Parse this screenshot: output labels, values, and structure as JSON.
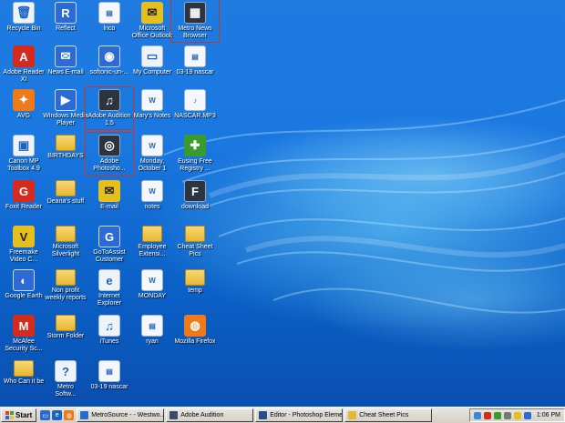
{
  "desktop_icons": [
    {
      "label": "Recycle Bin",
      "icon": "recycle-bin-icon",
      "glyph": "🗑"
    },
    {
      "label": "Reflect",
      "icon": "reflect-icon",
      "glyph": "R"
    },
    {
      "label": "lnco",
      "icon": "lnco-icon",
      "glyph": "▤"
    },
    {
      "label": "Microsoft\nOffice Outlook",
      "icon": "outlook-icon",
      "glyph": "✉"
    },
    {
      "label": "Metro News\nBrowser",
      "icon": "metro-news-browser-icon",
      "glyph": "▦"
    },
    {
      "label": "Adobe Reader\nXI",
      "icon": "adobe-reader-icon",
      "glyph": "A"
    },
    {
      "label": "News E-mail",
      "icon": "news-email-icon",
      "glyph": "✉"
    },
    {
      "label": "softonic-un-...",
      "icon": "softonic-icon",
      "glyph": "◉"
    },
    {
      "label": "My Computer",
      "icon": "my-computer-icon",
      "glyph": "▭"
    },
    {
      "label": "03-19 nascar",
      "icon": "nascar-file-icon",
      "glyph": "▤"
    },
    {
      "label": "AVG",
      "icon": "avg-icon",
      "glyph": "✦"
    },
    {
      "label": "Windows Media\nPlayer",
      "icon": "windows-media-player-icon",
      "glyph": "▶"
    },
    {
      "label": "Adobe Audition\n1.5",
      "icon": "adobe-audition-icon",
      "glyph": "♫"
    },
    {
      "label": "Mary's Notes",
      "icon": "marys-notes-icon",
      "glyph": "W"
    },
    {
      "label": "NASCAR.MP3",
      "icon": "nascar-mp3-icon",
      "glyph": "♪"
    },
    {
      "label": "Canon MP\nToolbox 4.9",
      "icon": "canon-toolbox-icon",
      "glyph": "▣"
    },
    {
      "label": "BIRTHDAYS",
      "icon": "folder-icon",
      "glyph": ""
    },
    {
      "label": "Adobe\nPhotosho...",
      "icon": "adobe-photoshop-icon",
      "glyph": "◎"
    },
    {
      "label": "Monday,\nOctober 1",
      "icon": "monday-october-doc-icon",
      "glyph": "W"
    },
    {
      "label": "Eusing Free\nRegistry ...",
      "icon": "eusing-registry-icon",
      "glyph": "✚"
    },
    {
      "label": "Foxit Reader",
      "icon": "foxit-reader-icon",
      "glyph": "G"
    },
    {
      "label": "Deana's stuff",
      "icon": "folder-icon",
      "glyph": ""
    },
    {
      "label": "E-mail",
      "icon": "email-icon",
      "glyph": "✉"
    },
    {
      "label": "notes",
      "icon": "notes-doc-icon",
      "glyph": "W"
    },
    {
      "label": "download",
      "icon": "download-icon",
      "glyph": "F"
    },
    {
      "label": "Freemake\nVideo C...",
      "icon": "freemake-icon",
      "glyph": "V"
    },
    {
      "label": "Microsoft\nSilverlight",
      "icon": "folder-icon",
      "glyph": ""
    },
    {
      "label": "GoToAssist\nCustomer",
      "icon": "gotoassist-icon",
      "glyph": "G"
    },
    {
      "label": "Employee\nExtensi...",
      "icon": "employee-folder-icon",
      "glyph": ""
    },
    {
      "label": "Cheat Sheet\nPics",
      "icon": "folder-icon",
      "glyph": ""
    },
    {
      "label": "Google Earth",
      "icon": "google-earth-icon",
      "glyph": "◐"
    },
    {
      "label": "Non profit\nweekly reports",
      "icon": "folder-icon",
      "glyph": ""
    },
    {
      "label": "Internet\nExplorer",
      "icon": "internet-explorer-icon",
      "glyph": "e"
    },
    {
      "label": "MONDAY",
      "icon": "monday-doc-icon",
      "glyph": "W"
    },
    {
      "label": "temp",
      "icon": "temp-folder-icon",
      "glyph": ""
    },
    {
      "label": "McAfee\nSecurity Sc...",
      "icon": "mcafee-icon",
      "glyph": "M"
    },
    {
      "label": "Storm Folder",
      "icon": "folder-icon",
      "glyph": ""
    },
    {
      "label": "iTunes",
      "icon": "itunes-icon",
      "glyph": "♫"
    },
    {
      "label": "ryan",
      "icon": "ryan-doc-icon",
      "glyph": "▤"
    },
    {
      "label": "Mozilla Firefox",
      "icon": "firefox-icon",
      "glyph": "◍"
    },
    {
      "label": "Who Can it be",
      "icon": "folder-icon",
      "glyph": ""
    },
    {
      "label": "Metro\nSoftw...",
      "icon": "metro-software-icon",
      "glyph": "?"
    },
    {
      "label": "03-19 nascar",
      "icon": "nascar-file-icon",
      "glyph": "▤"
    }
  ],
  "taskbar": {
    "start_label": "Start",
    "tasks": [
      {
        "label": "MetroSource - - Westwo...",
        "icon": "browser-icon",
        "color": "#2a6bd1"
      },
      {
        "label": "Adobe Audition",
        "icon": "adobe-audition-icon",
        "color": "#3b4a6b"
      },
      {
        "label": "Editor - Photoshop Eleme...",
        "icon": "photoshop-icon",
        "color": "#2a4a8a"
      },
      {
        "label": "Cheat Sheet Pics",
        "icon": "folder-icon",
        "color": "#e8b630"
      }
    ],
    "clock": "1:06 PM"
  },
  "colors": {
    "accent": "#1a78e0",
    "selection_outline": "#c0392b",
    "taskbar": "#d4d0c8"
  }
}
